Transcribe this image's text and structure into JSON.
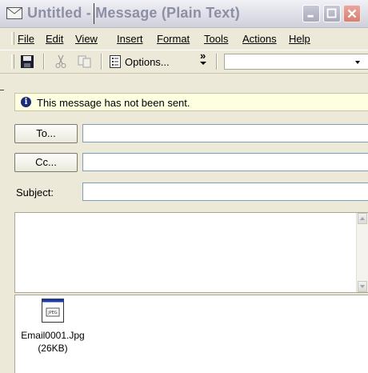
{
  "window": {
    "title": "Untitled - Message (Plain Text)"
  },
  "menu": {
    "items": [
      "File",
      "Edit",
      "View",
      "Insert",
      "Format",
      "Tools",
      "Actions",
      "Help"
    ]
  },
  "toolbar": {
    "options_label": "Options...",
    "overflow_label": "»"
  },
  "info_bar": {
    "text": "This message has not been sent."
  },
  "header": {
    "to_label": "To...",
    "cc_label": "Cc...",
    "subject_label": "Subject:",
    "to_value": "",
    "cc_value": "",
    "subject_value": ""
  },
  "body": {
    "text": ""
  },
  "attachment": {
    "name": "Email0001.Jpg",
    "size": "(26KB)",
    "icon": "jpeg-file-icon"
  },
  "colors": {
    "info_bg": "#fefee0",
    "title_text": "#8e8fa5",
    "close_button": "#d7806f"
  }
}
